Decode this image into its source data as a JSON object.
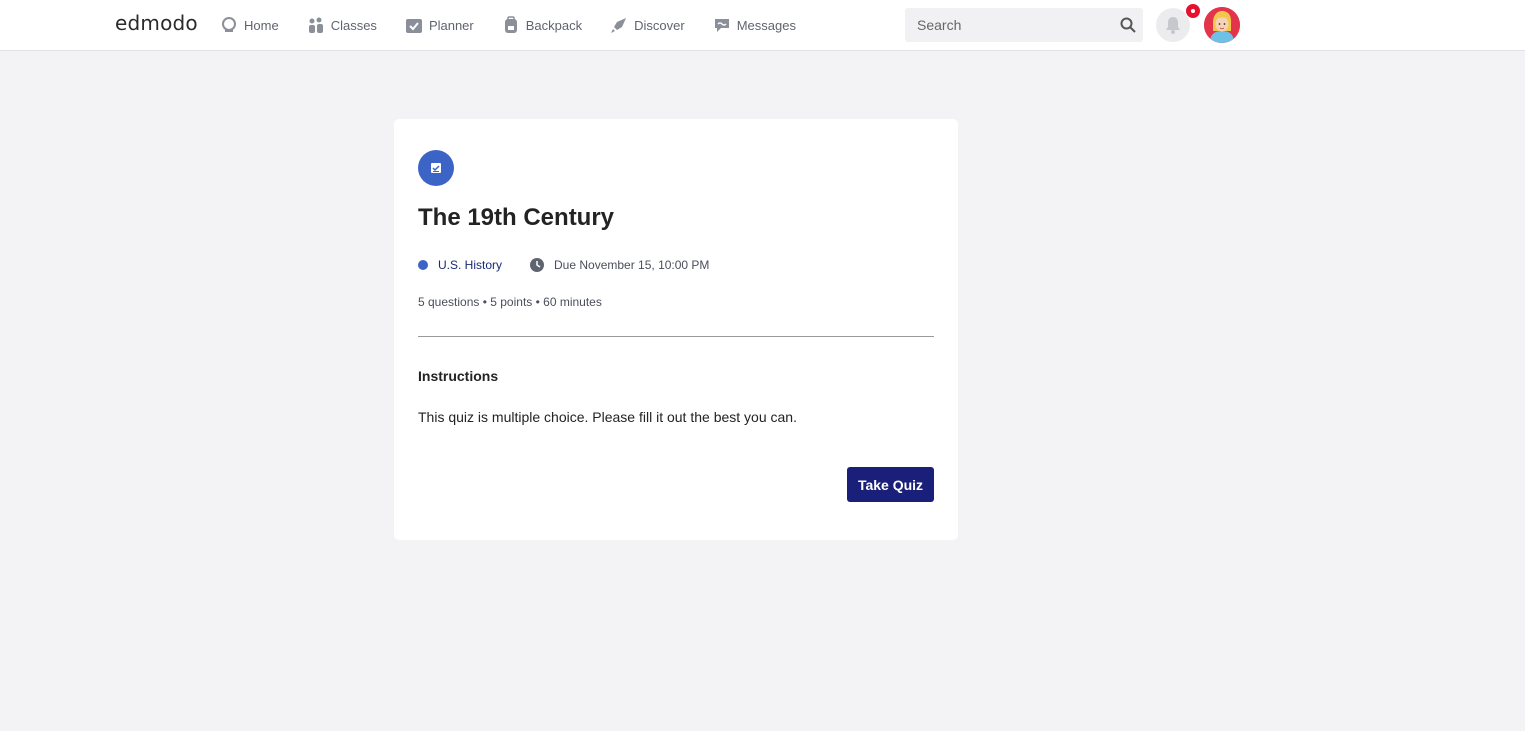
{
  "header": {
    "logo": "edmodo",
    "nav": [
      {
        "label": "Home",
        "icon": "home-icon"
      },
      {
        "label": "Classes",
        "icon": "classes-icon"
      },
      {
        "label": "Planner",
        "icon": "planner-icon"
      },
      {
        "label": "Backpack",
        "icon": "backpack-icon"
      },
      {
        "label": "Discover",
        "icon": "discover-icon"
      },
      {
        "label": "Messages",
        "icon": "messages-icon"
      }
    ],
    "search": {
      "placeholder": "Search",
      "value": ""
    },
    "colors": {
      "badge": "#e8102f",
      "avatar_bg": "#e4344c"
    }
  },
  "quiz": {
    "title": "The 19th Century",
    "class_name": "U.S. History",
    "due": "Due November 15, 10:00 PM",
    "stats": "5 questions • 5 points • 60 minutes",
    "instructions_heading": "Instructions",
    "instructions": "This quiz is multiple choice. Please fill it out the best you can.",
    "take_button": "Take Quiz",
    "colors": {
      "accent": "#3c64c7",
      "button": "#1a2079"
    }
  }
}
